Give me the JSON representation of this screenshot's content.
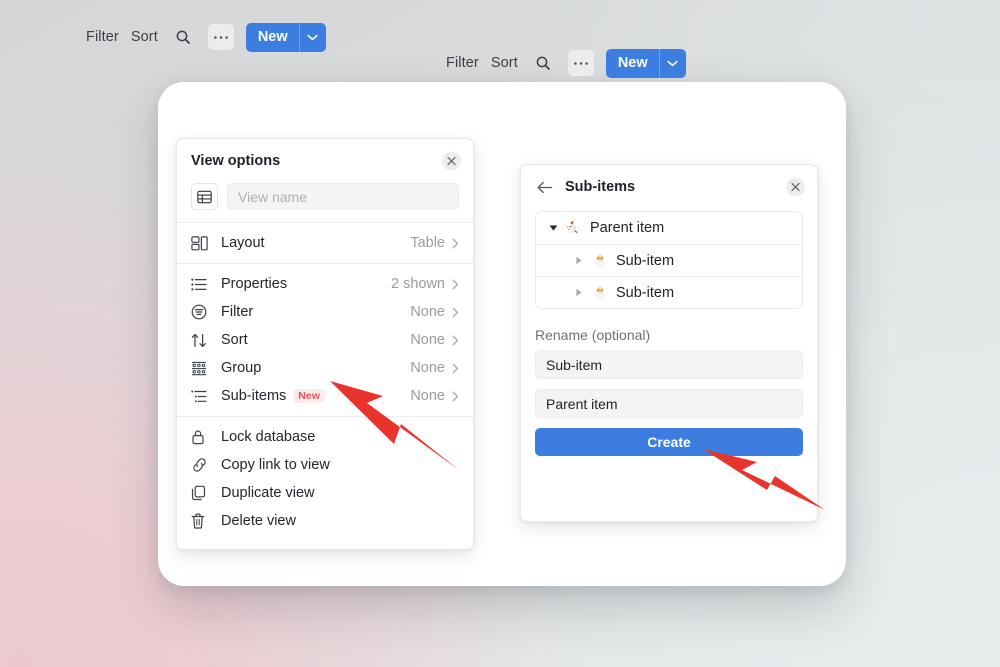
{
  "colors": {
    "accent_blue": "#3b7ee0",
    "arrow_red": "#e8342c",
    "badge_bg": "#fdeaea",
    "badge_text": "#e1555f",
    "panel_bg": "#ffffff",
    "field_bg": "#f4f4f4",
    "muted_text": "#9a9da1",
    "backdrop_pink": "#eccdd2",
    "backdrop_gray": "#d4d6d8",
    "backdrop_blue_gray": "#e6eced"
  },
  "toolbar_left": {
    "filter_label": "Filter",
    "sort_label": "Sort",
    "search_icon": "search-icon",
    "more_icon": "ellipsis-icon",
    "new_label": "New",
    "new_caret_icon": "chevron-down-icon"
  },
  "toolbar_right": {
    "filter_label": "Filter",
    "sort_label": "Sort",
    "search_icon": "search-icon",
    "more_icon": "ellipsis-icon",
    "new_label": "New",
    "new_caret_icon": "chevron-down-icon"
  },
  "view_options_panel": {
    "title": "View options",
    "close_icon": "close-icon",
    "view_name": {
      "icon": "table-icon",
      "value": "",
      "placeholder": "View name"
    },
    "groups": [
      {
        "items": [
          {
            "icon": "layout-icon",
            "label": "Layout",
            "value": "Table",
            "badge": "",
            "chevron": "chevron-right-icon"
          }
        ]
      },
      {
        "items": [
          {
            "icon": "list-icon",
            "label": "Properties",
            "value": "2 shown",
            "badge": "",
            "chevron": "chevron-right-icon"
          },
          {
            "icon": "filter-icon",
            "label": "Filter",
            "value": "None",
            "badge": "",
            "chevron": "chevron-right-icon"
          },
          {
            "icon": "sort-icon",
            "label": "Sort",
            "value": "None",
            "badge": "",
            "chevron": "chevron-right-icon"
          },
          {
            "icon": "group-icon",
            "label": "Group",
            "value": "None",
            "badge": "",
            "chevron": "chevron-right-icon"
          },
          {
            "icon": "subitems-icon",
            "label": "Sub-items",
            "value": "None",
            "badge": "New",
            "chevron": "chevron-right-icon"
          }
        ]
      },
      {
        "items": [
          {
            "icon": "lock-icon",
            "label": "Lock database",
            "value": "",
            "badge": "",
            "chevron": ""
          },
          {
            "icon": "link-icon",
            "label": "Copy link to view",
            "value": "",
            "badge": "",
            "chevron": ""
          },
          {
            "icon": "duplicate-icon",
            "label": "Duplicate view",
            "value": "",
            "badge": "",
            "chevron": ""
          },
          {
            "icon": "trash-icon",
            "label": "Delete view",
            "value": "",
            "badge": "",
            "chevron": ""
          }
        ]
      }
    ]
  },
  "sub_items_panel": {
    "back_icon": "arrow-left-icon",
    "title": "Sub-items",
    "close_icon": "close-icon",
    "tree": [
      {
        "level": 0,
        "caret": "caret-down-icon",
        "emoji": "rooster-emoji",
        "label": "Parent item"
      },
      {
        "level": 1,
        "caret": "caret-right-icon",
        "emoji": "hatching-chick-emoji",
        "label": "Sub-item"
      },
      {
        "level": 1,
        "caret": "caret-right-icon",
        "emoji": "hatching-chick-emoji",
        "label": "Sub-item"
      }
    ],
    "form": {
      "label": "Rename (optional)",
      "field_sub_item": "Sub-item",
      "field_parent_item": "Parent item",
      "create_label": "Create"
    }
  },
  "annotations": {
    "arrow_1": "red-arrow-pointing-to-sub-items-row",
    "arrow_2": "red-arrow-pointing-to-create-button"
  }
}
